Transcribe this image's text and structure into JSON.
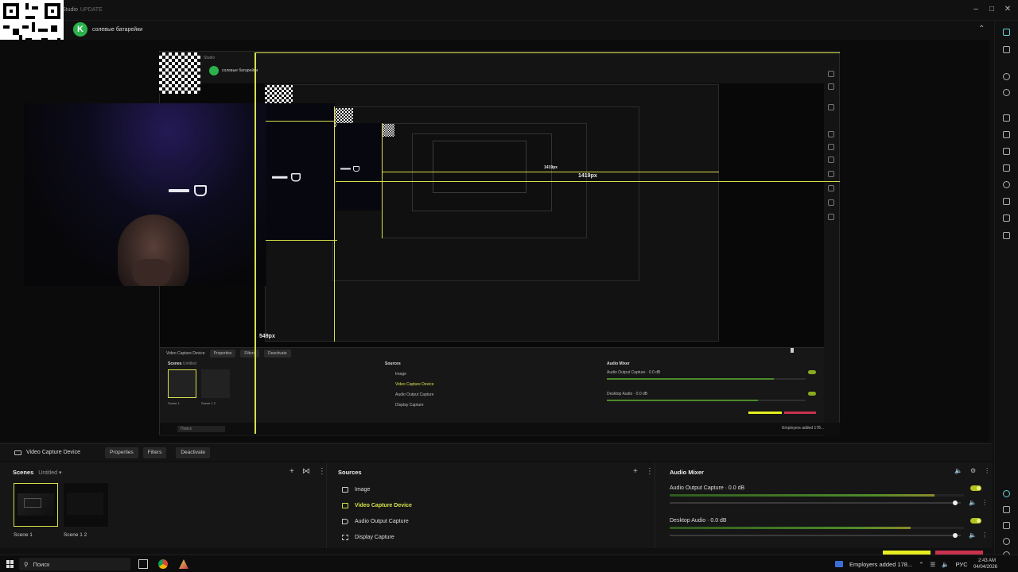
{
  "window": {
    "title": "Studio",
    "update_badge": "UPDATE",
    "profile_name": "солевые батарейки",
    "logo_letter": "K"
  },
  "preview": {
    "guide_h_label": "1419px",
    "guide_h_label_inner": "1419px",
    "guide_v_label": "549px",
    "nested_scene_label_1": "Scene 1",
    "nested_scene_label_2": "Scene 1 2",
    "nested_device": "Video Capture Device",
    "nested_properties": "Properties",
    "nested_filters": "Filters",
    "nested_deactivate": "Deactivate",
    "nested_scenes": "Scenes",
    "nested_untitled": "Untitled",
    "nested_sources": "Sources",
    "nested_src_image": "Image",
    "nested_src_video": "Video Capture Device",
    "nested_src_audio": "Audio Output Capture",
    "nested_src_display": "Display Capture",
    "nested_mixer": "Audio Mixer",
    "nested_chan1": "Audio Output Capture · 0.0 dB",
    "nested_chan2": "Desktop Audio · 0.0 dB",
    "nested_search": "Поиск",
    "nested_tray": "Employers added 178..."
  },
  "source_bar": {
    "device_name": "Video Capture Device",
    "properties_label": "Properties",
    "filters_label": "Filters",
    "deactivate_label": "Deactivate"
  },
  "scenes": {
    "title": "Scenes",
    "collection": "Untitled",
    "items": [
      {
        "label": "Scene 1",
        "selected": true
      },
      {
        "label": "Scene 1 2",
        "selected": false
      }
    ]
  },
  "sources": {
    "title": "Sources",
    "items": [
      {
        "label": "Image",
        "icon": "image-icon",
        "active": false
      },
      {
        "label": "Video Capture Device",
        "icon": "camera-icon",
        "active": true
      },
      {
        "label": "Audio Output Capture",
        "icon": "speaker-icon",
        "active": false
      },
      {
        "label": "Display Capture",
        "icon": "display-icon",
        "active": false
      }
    ]
  },
  "mixer": {
    "title": "Audio Mixer",
    "channels": [
      {
        "label": "Audio Output Capture · 0.0 dB",
        "level": 0.9,
        "volume": 0.99
      },
      {
        "label": "Desktop Audio · 0.0 dB",
        "level": 0.82,
        "volume": 0.99
      }
    ]
  },
  "taskbar": {
    "search_placeholder": "Поиск",
    "notification": "Employers added 178...",
    "lang": "РУС",
    "time": "2:43 AM",
    "date": "04/04/2026"
  },
  "colors": {
    "accent": "#d7e04a",
    "background": "#101010",
    "toggle_on": "#b2c320",
    "stream_yellow": "#e5ee1e",
    "stream_red": "#c9324f"
  }
}
